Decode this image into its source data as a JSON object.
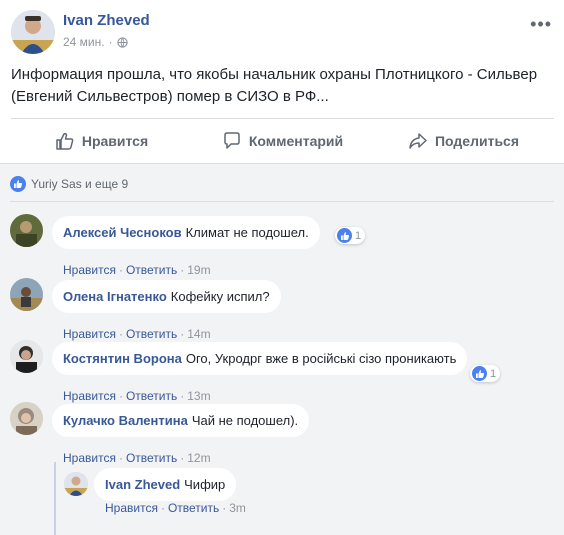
{
  "post": {
    "author": "Ivan Zheved",
    "time": "24 мин.",
    "dot": "·",
    "text": "Информация прошла, что якобы начальник охраны Плотницкого - Сильвер (Евгений Сильвестров) помер в СИЗО в РФ..."
  },
  "actions": {
    "like": "Нравится",
    "comment": "Комментарий",
    "share": "Поделиться"
  },
  "reactions": {
    "summary": "Yuriy Sas и еще 9"
  },
  "comments": [
    {
      "name": "Алексей Чесноков",
      "text": "Климат не подошел.",
      "like": "Нравится",
      "reply": "Ответить",
      "time": "19m",
      "sep": "·",
      "reaction_count": "1"
    },
    {
      "name": "Олена Ігнатенко",
      "text": "Кофейку испил?",
      "like": "Нравится",
      "reply": "Ответить",
      "time": "14m",
      "sep": "·"
    },
    {
      "name": "Костянтин Ворона",
      "text": "Ого, Укродрг вже в російські сізо проникають",
      "like": "Нравится",
      "reply": "Ответить",
      "time": "13m",
      "sep": "·",
      "reaction_count": "1"
    },
    {
      "name": "Кулачко Валентина",
      "text": "Чай не подошел).",
      "like": "Нравится",
      "reply": "Ответить",
      "time": "12m",
      "sep": "·"
    }
  ],
  "reply": {
    "name": "Ivan Zheved",
    "text": "Чифир",
    "like": "Нравится",
    "reply": "Ответить",
    "time": "3m",
    "sep": "·"
  },
  "colors": {
    "link": "#385898",
    "like_badge": "#4a80f0",
    "meta": "#90949c",
    "comment_bg": "#f2f3f5"
  }
}
